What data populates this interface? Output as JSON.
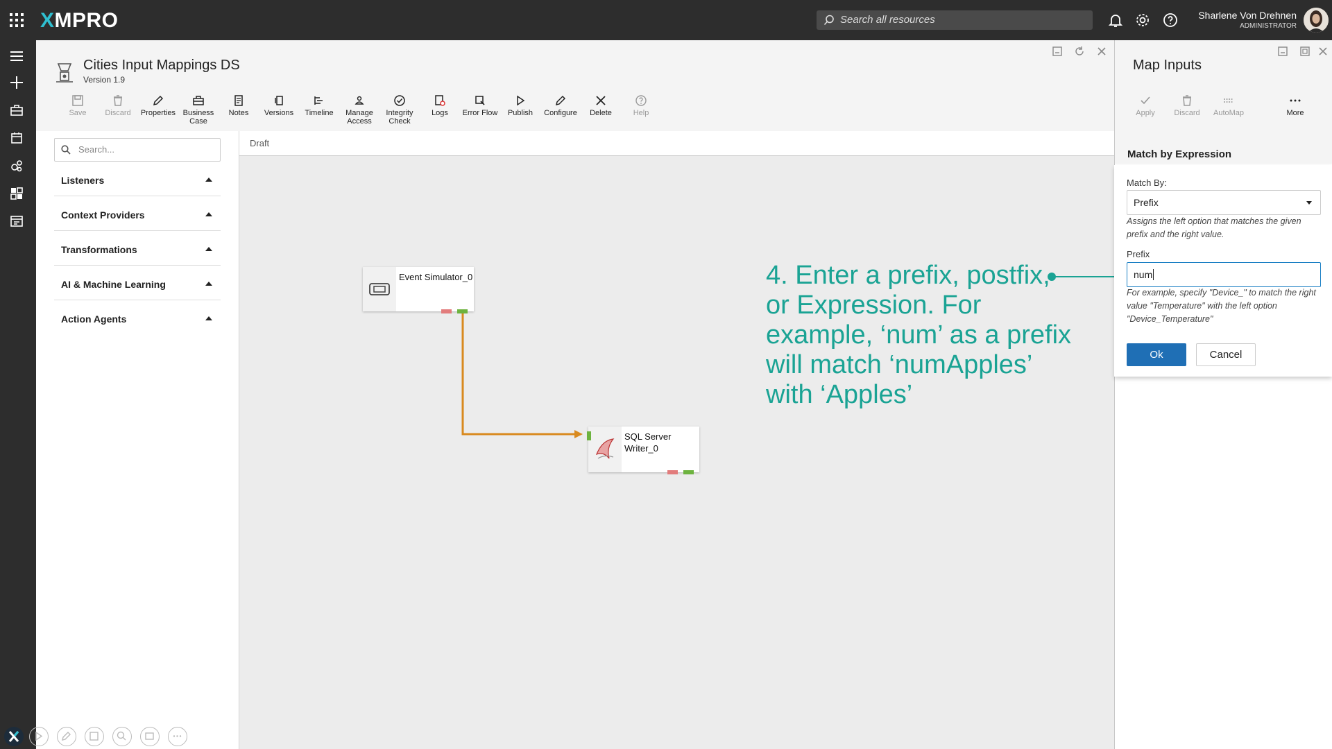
{
  "header": {
    "brand_x": "X",
    "brand_rest": "MPRO",
    "search_placeholder": "Search all resources",
    "user_name": "Sharlene Von Drehnen",
    "user_role": "ADMINISTRATOR"
  },
  "editor": {
    "title": "Cities Input Mappings DS",
    "version": "Version 1.9",
    "toolbar": [
      {
        "label": "Save",
        "icon": "save-icon",
        "enabled": false
      },
      {
        "label": "Discard",
        "icon": "trash-icon",
        "enabled": false
      },
      {
        "label": "Properties",
        "icon": "pencil-icon",
        "enabled": true
      },
      {
        "label": "Business Case",
        "icon": "briefcase-icon",
        "enabled": true
      },
      {
        "label": "Notes",
        "icon": "notes-icon",
        "enabled": true
      },
      {
        "label": "Versions",
        "icon": "versions-icon",
        "enabled": true
      },
      {
        "label": "Timeline",
        "icon": "timeline-icon",
        "enabled": true
      },
      {
        "label": "Manage Access",
        "icon": "access-icon",
        "enabled": true
      },
      {
        "label": "Integrity Check",
        "icon": "check-circle-icon",
        "enabled": true
      },
      {
        "label": "Logs",
        "icon": "logs-icon",
        "enabled": true
      },
      {
        "label": "Error Flow",
        "icon": "error-flow-icon",
        "enabled": true
      },
      {
        "label": "Publish",
        "icon": "play-icon",
        "enabled": true
      },
      {
        "label": "Configure",
        "icon": "pencil-icon",
        "enabled": true
      },
      {
        "label": "Delete",
        "icon": "close-icon",
        "enabled": true
      },
      {
        "label": "Help",
        "icon": "help-icon",
        "enabled": false
      }
    ],
    "search_placeholder": "Search...",
    "categories": [
      "Listeners",
      "Context Providers",
      "Transformations",
      "AI & Machine Learning",
      "Action Agents"
    ],
    "canvas_tab": "Draft",
    "nodes": [
      {
        "label": "Event Simulator_0"
      },
      {
        "label": "SQL Server Writer_0"
      }
    ]
  },
  "annotation": {
    "text": "4. Enter a prefix, postfix, or Expression. For example, ‘num’ as a prefix will match ‘numApples’ with ‘Apples’",
    "color": "#1aa394"
  },
  "map_inputs": {
    "title": "Map Inputs",
    "actions": [
      {
        "label": "Apply",
        "icon": "check-icon"
      },
      {
        "label": "Discard",
        "icon": "trash-icon"
      },
      {
        "label": "AutoMap",
        "icon": "automap-icon"
      },
      {
        "label": "More",
        "icon": "more-icon"
      }
    ],
    "section_title": "Match by Expression",
    "match_by_label": "Match By:",
    "match_by_value": "Prefix",
    "match_by_help": "Assigns the left option that matches the given prefix and the right value.",
    "prefix_label": "Prefix",
    "prefix_value": "num",
    "prefix_help": "For example, specify \"Device_\" to match the right value \"Temperature\" with the left option \"Device_Temperature\"",
    "ok_label": "Ok",
    "cancel_label": "Cancel"
  },
  "colors": {
    "accent": "#1f6fb5",
    "connector": "#d98a1f",
    "port_green": "#6db33f",
    "port_red": "#e27c7c",
    "topbar": "#2d2d2d"
  }
}
